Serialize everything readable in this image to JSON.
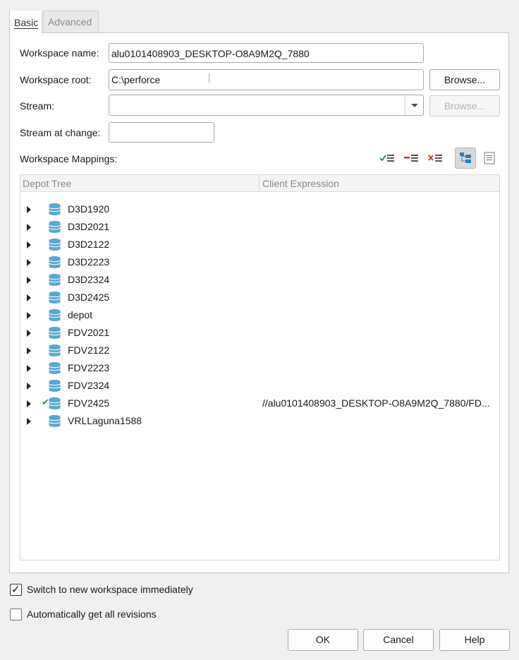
{
  "tabs": {
    "basic": "Basic",
    "advanced": "Advanced"
  },
  "form": {
    "workspace_name_label": "Workspace name:",
    "workspace_name_value": "alu0101408903_DESKTOP-O8A9M2Q_7880",
    "workspace_root_label": "Workspace root:",
    "workspace_root_value": "C:\\perforce",
    "browse_label": "Browse...",
    "stream_label": "Stream:",
    "stream_value": "",
    "stream_browse_label": "Browse...",
    "stream_at_change_label": "Stream at change:",
    "stream_at_change_value": "",
    "mappings_label": "Workspace Mappings:"
  },
  "mappings": {
    "columns": {
      "depot_tree": "Depot Tree",
      "client_expression": "Client Expression"
    },
    "rows": [
      {
        "name": "D3D1920",
        "expression": "",
        "mapped": false
      },
      {
        "name": "D3D2021",
        "expression": "",
        "mapped": false
      },
      {
        "name": "D3D2122",
        "expression": "",
        "mapped": false
      },
      {
        "name": "D3D2223",
        "expression": "",
        "mapped": false
      },
      {
        "name": "D3D2324",
        "expression": "",
        "mapped": false
      },
      {
        "name": "D3D2425",
        "expression": "",
        "mapped": false
      },
      {
        "name": "depot",
        "expression": "",
        "mapped": false
      },
      {
        "name": "FDV2021",
        "expression": "",
        "mapped": false
      },
      {
        "name": "FDV2122",
        "expression": "",
        "mapped": false
      },
      {
        "name": "FDV2223",
        "expression": "",
        "mapped": false
      },
      {
        "name": "FDV2324",
        "expression": "",
        "mapped": false
      },
      {
        "name": "FDV2425",
        "expression": "//alu0101408903_DESKTOP-O8A9M2Q_7880/FD...",
        "mapped": true
      },
      {
        "name": "VRLLaguna1588",
        "expression": "",
        "mapped": false
      }
    ]
  },
  "options": {
    "switch_workspace_label": "Switch to new workspace immediately",
    "switch_workspace_checked": true,
    "get_revisions_label": "Automatically get all revisions",
    "get_revisions_checked": false
  },
  "buttons": {
    "ok": "OK",
    "cancel": "Cancel",
    "help": "Help"
  },
  "colors": {
    "check_green": "#2e9a3a",
    "db_blue": "#58a7d6",
    "remove_red": "#d9342b"
  }
}
